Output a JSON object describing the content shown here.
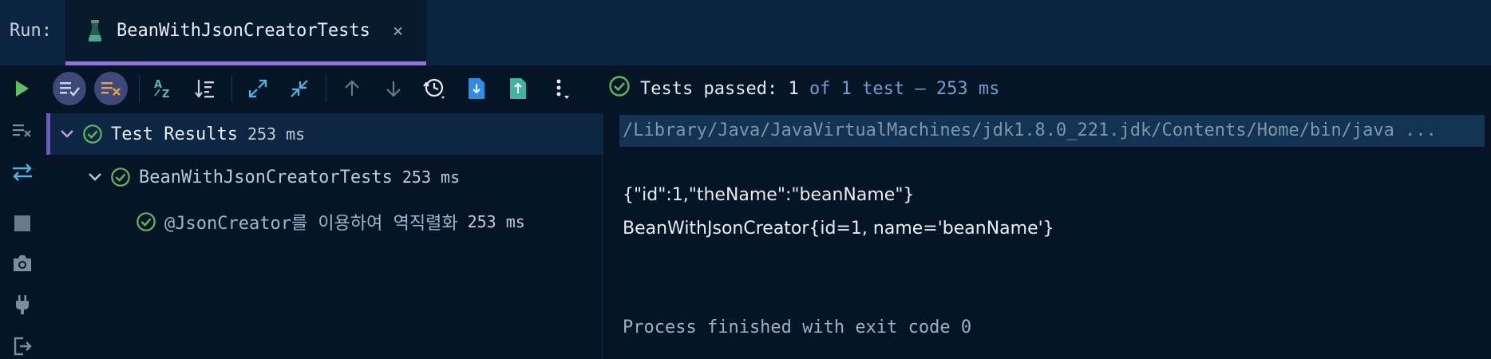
{
  "header": {
    "run_label": "Run:",
    "tab_title": "BeanWithJsonCreatorTests",
    "close_glyph": "×",
    "accent": "#9a6ee6"
  },
  "toolbar": {
    "status_prefix": "Tests passed:",
    "status_count": "1",
    "status_rest": "of 1 test – 253 ms"
  },
  "tree": {
    "root": {
      "label": "Test Results",
      "time": "253 ms"
    },
    "suite": {
      "label": "BeanWithJsonCreatorTests",
      "time": "253 ms"
    },
    "test": {
      "label": "@JsonCreator를 이용하여 역직렬화",
      "time": "253 ms"
    }
  },
  "console": {
    "command": "/Library/Java/JavaVirtualMachines/jdk1.8.0_221.jdk/Contents/Home/bin/java ...",
    "lines": [
      "{\"id\":1,\"theName\":\"beanName\"}",
      "BeanWithJsonCreator{id=1, name='beanName'}"
    ],
    "process": "Process finished with exit code 0"
  },
  "colors": {
    "pass_green": "#5fb65f",
    "background": "#061526",
    "topbar": "#0b2540"
  }
}
